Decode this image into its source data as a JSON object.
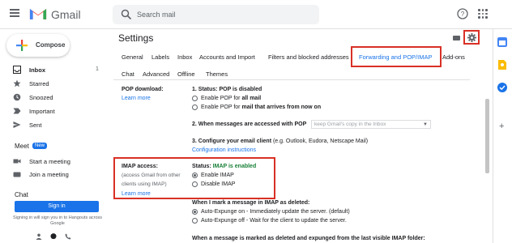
{
  "app": {
    "name": "Gmail"
  },
  "search": {
    "placeholder": "Search mail"
  },
  "nav": {
    "compose": "Compose",
    "items": [
      {
        "label": "Inbox",
        "count": "1"
      },
      {
        "label": "Starred"
      },
      {
        "label": "Snoozed"
      },
      {
        "label": "Important"
      },
      {
        "label": "Sent"
      }
    ],
    "meet": {
      "heading": "Meet",
      "badge": "New",
      "items": [
        "Start a meeting",
        "Join a meeting"
      ]
    },
    "chat": {
      "heading": "Chat",
      "signin": "Sign in",
      "note": "Signing in will sign you in to Hangouts across Google"
    }
  },
  "settings": {
    "title": "Settings",
    "tabs_row1": [
      "General",
      "Labels",
      "Inbox",
      "Accounts and Import",
      "Filters and blocked addresses",
      "Forwarding and POP/IMAP",
      "Add-ons"
    ],
    "tabs_row2": [
      "Chat",
      "Advanced",
      "Offline",
      "Themes"
    ],
    "active_tab": "Forwarding and POP/IMAP",
    "pop": {
      "label": "POP download:",
      "link": "Learn more",
      "status_prefix": "1. Status: POP is disabled",
      "opt1_prefix": "Enable POP for ",
      "opt1_bold": "all mail",
      "opt2_prefix": "Enable POP for ",
      "opt2_bold": "mail that arrives from now on",
      "step2": "2. When messages are accessed with POP",
      "step2_select": "keep Gmail's copy in the Inbox",
      "step3_bold": "3. Configure your email client",
      "step3_rest": " (e.g. Outlook, Eudora, Netscape Mail)",
      "step3_link": "Configuration instructions"
    },
    "imap": {
      "label": "IMAP access:",
      "sub": "(access Gmail from other clients using IMAP)",
      "link": "Learn more",
      "status_prefix": "Status: ",
      "status_value": "IMAP is enabled",
      "opt_enable": "Enable IMAP",
      "opt_disable": "Disable IMAP",
      "deleted_heading": "When I mark a message in IMAP as deleted:",
      "auto_on_bold": "Auto-Expunge on",
      "auto_on_rest": " - Immediately update the server. (default)",
      "auto_off_bold": "Auto-Expunge off",
      "auto_off_rest": " - Wait for the client to update the server.",
      "expunged_heading": "When a message is marked as deleted and expunged from the last visible IMAP folder:"
    }
  },
  "colors": {
    "accent": "#1a73e8",
    "highlight_box": "#d93025",
    "status_green": "#188038"
  }
}
